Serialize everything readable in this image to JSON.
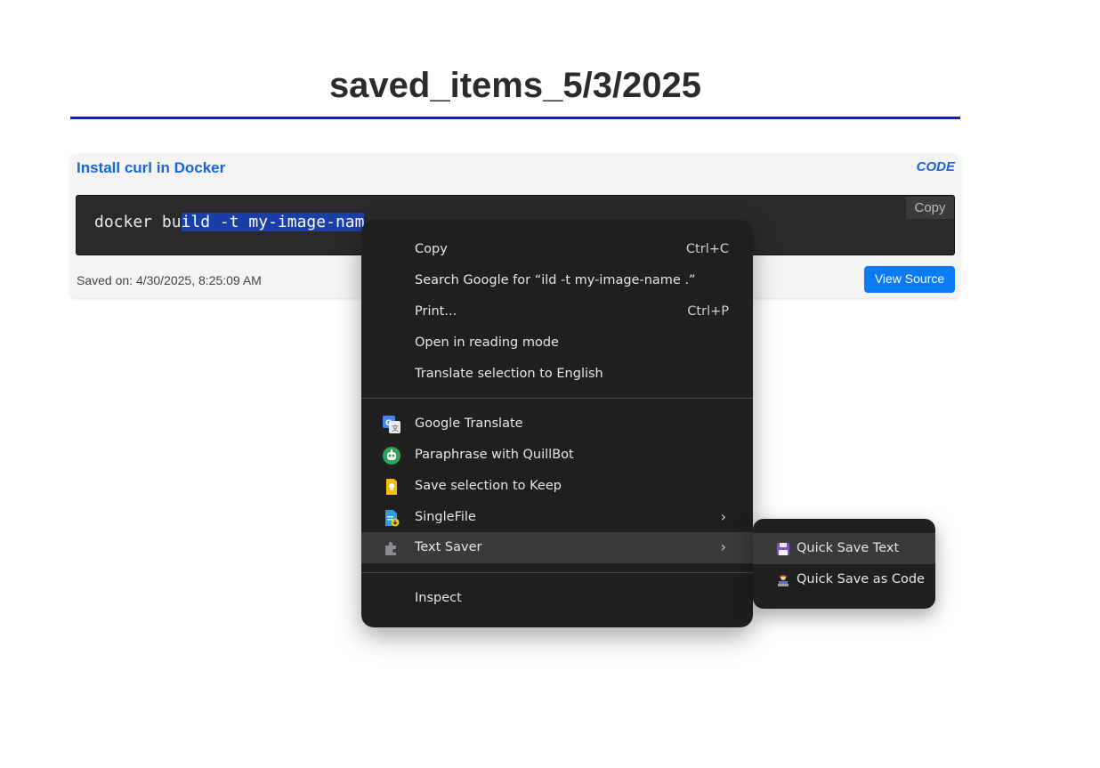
{
  "page": {
    "title": "saved_items_5/3/2025"
  },
  "card": {
    "title": "Install curl in Docker",
    "type": "CODE",
    "code_before": "docker bu",
    "code_selected": "ild -t my-image-nam",
    "copy_label": "Copy",
    "saved_on": "Saved on: 4/30/2025, 8:25:09 AM",
    "view_source_label": "View Source"
  },
  "context_menu": {
    "items": [
      {
        "label": "Copy",
        "shortcut": "Ctrl+C"
      },
      {
        "label": "Search Google for “ild -t my-image-name .”"
      },
      {
        "label": "Print...",
        "shortcut": "Ctrl+P"
      },
      {
        "label": "Open in reading mode"
      },
      {
        "label": "Translate selection to English"
      }
    ],
    "extensions": [
      {
        "label": "Google Translate",
        "icon": "google-translate-icon"
      },
      {
        "label": "Paraphrase with QuillBot",
        "icon": "quillbot-icon"
      },
      {
        "label": "Save selection to Keep",
        "icon": "keep-icon"
      },
      {
        "label": "SingleFile",
        "icon": "singlefile-icon",
        "arrow": "›"
      },
      {
        "label": "Text Saver",
        "icon": "puzzle-icon",
        "arrow": "›"
      }
    ],
    "inspect_label": "Inspect"
  },
  "submenu": {
    "items": [
      {
        "label": "Quick Save Text",
        "icon": "floppy-disk-icon"
      },
      {
        "label": "Quick Save as Code",
        "icon": "technologist-icon"
      }
    ]
  },
  "colors": {
    "accent": "#1565e0",
    "button": "#0a7bf5",
    "rule": "#1a14d6",
    "menu_bg": "#1f1f1f",
    "selection": "#1a3fa8"
  }
}
